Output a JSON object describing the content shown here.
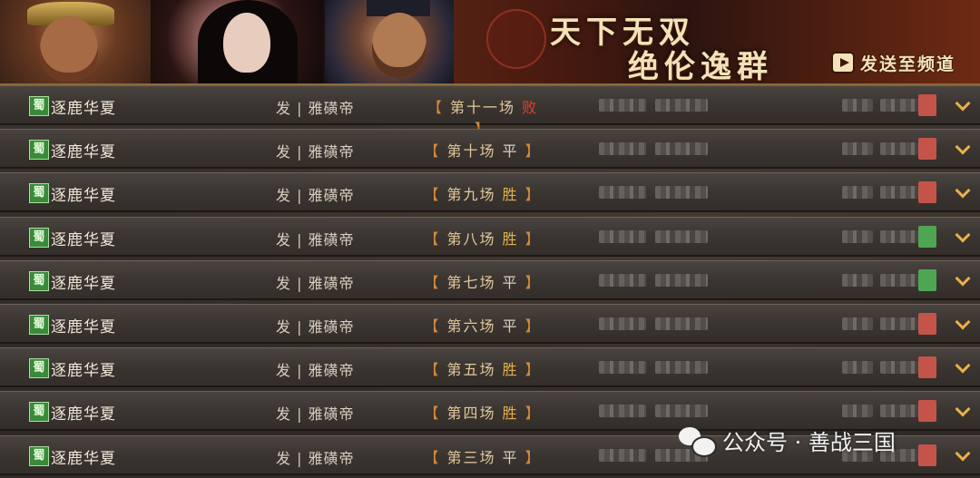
{
  "banner": {
    "title_line1": "天下无双",
    "title_line2": "绝伦逸群",
    "send_label": "发送至频道"
  },
  "rows": [
    {
      "seal": "蜀",
      "server": "逐鹿华夏",
      "players": "发 | 雅磺帝",
      "round": "第十一场",
      "result": "败",
      "result_type": "lose",
      "mark_color": "red"
    },
    {
      "seal": "蜀",
      "server": "逐鹿华夏",
      "players": "发 | 雅磺帝",
      "round": "第十场",
      "result": "平",
      "result_type": "draw",
      "mark_color": "red"
    },
    {
      "seal": "蜀",
      "server": "逐鹿华夏",
      "players": "发 | 雅磺帝",
      "round": "第九场",
      "result": "胜",
      "result_type": "win",
      "mark_color": "red"
    },
    {
      "seal": "蜀",
      "server": "逐鹿华夏",
      "players": "发 | 雅磺帝",
      "round": "第八场",
      "result": "胜",
      "result_type": "win",
      "mark_color": "green"
    },
    {
      "seal": "蜀",
      "server": "逐鹿华夏",
      "players": "发 | 雅磺帝",
      "round": "第七场",
      "result": "平",
      "result_type": "draw",
      "mark_color": "green"
    },
    {
      "seal": "蜀",
      "server": "逐鹿华夏",
      "players": "发 | 雅磺帝",
      "round": "第六场",
      "result": "平",
      "result_type": "draw",
      "mark_color": "red"
    },
    {
      "seal": "蜀",
      "server": "逐鹿华夏",
      "players": "发 | 雅磺帝",
      "round": "第五场",
      "result": "胜",
      "result_type": "win",
      "mark_color": "red"
    },
    {
      "seal": "蜀",
      "server": "逐鹿华夏",
      "players": "发 | 雅磺帝",
      "round": "第四场",
      "result": "胜",
      "result_type": "win",
      "mark_color": "red"
    },
    {
      "seal": "蜀",
      "server": "逐鹿华夏",
      "players": "发 | 雅磺帝",
      "round": "第三场",
      "result": "平",
      "result_type": "draw",
      "mark_color": "red"
    }
  ],
  "watermark": {
    "text": "公众号 · 善战三国"
  },
  "colors": {
    "win": "#e2b24a",
    "draw": "#d8cfc0",
    "lose": "#e0402a",
    "accent": "#e9b04a"
  }
}
